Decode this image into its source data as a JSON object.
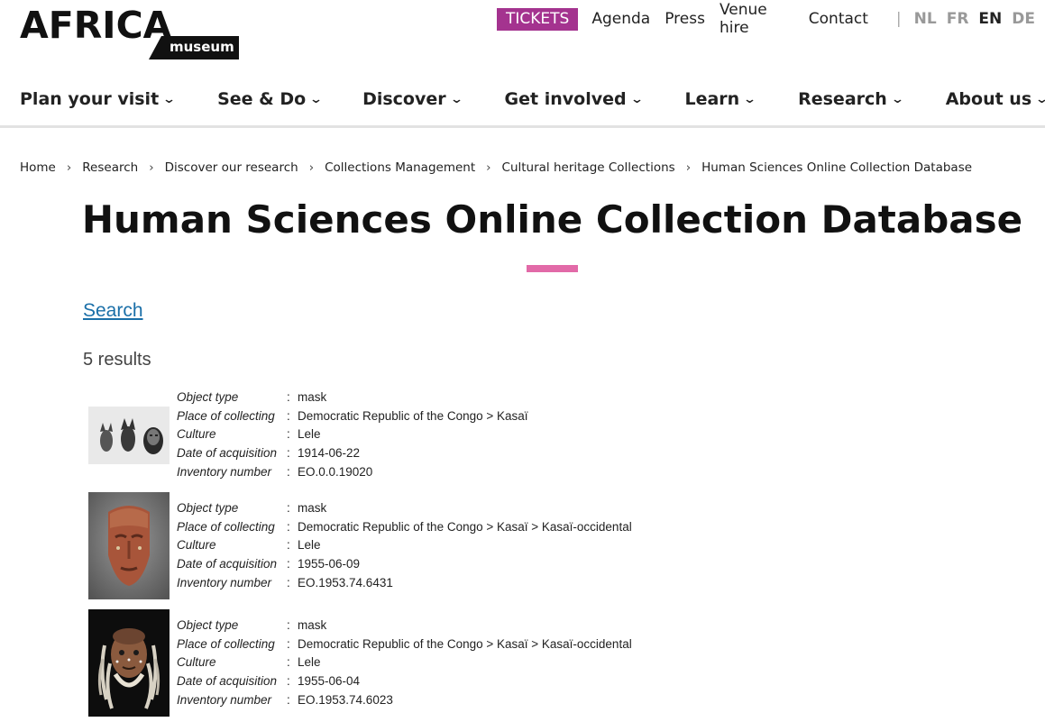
{
  "logo": {
    "word": "AFRICA",
    "sub": "museum"
  },
  "topnav": {
    "tickets": "TICKETS",
    "links": [
      "Agenda",
      "Press",
      "Venue hire",
      "Contact"
    ],
    "separator": "|",
    "languages": [
      "NL",
      "FR",
      "EN",
      "DE"
    ],
    "active_language": "EN"
  },
  "mainnav": [
    "Plan your visit",
    "See & Do",
    "Discover",
    "Get involved",
    "Learn",
    "Research",
    "About us"
  ],
  "breadcrumb": [
    "Home",
    "Research",
    "Discover our research",
    "Collections Management",
    "Cultural heritage Collections",
    "Human Sciences Online Collection Database"
  ],
  "page": {
    "title": "Human Sciences Online Collection Database",
    "search_link": "Search",
    "results_count": "5 results"
  },
  "field_labels": {
    "object_type": "Object type",
    "place": "Place of collecting",
    "culture": "Culture",
    "date": "Date of acquisition",
    "inventory": "Inventory number"
  },
  "results": [
    {
      "object_type": "mask",
      "place": "Democratic Republic of the Congo > Kasaï",
      "culture": "Lele",
      "date": "1914-06-22",
      "inventory": "EO.0.0.19020"
    },
    {
      "object_type": "mask",
      "place": "Democratic Republic of the Congo > Kasaï > Kasaï-occidental",
      "culture": "Lele",
      "date": "1955-06-09",
      "inventory": "EO.1953.74.6431"
    },
    {
      "object_type": "mask",
      "place": "Democratic Republic of the Congo > Kasaï > Kasaï-occidental",
      "culture": "Lele",
      "date": "1955-06-04",
      "inventory": "EO.1953.74.6023"
    }
  ],
  "colors": {
    "tickets_bg": "#a4338f",
    "accent": "#e26aa8",
    "link": "#1a6fa8"
  }
}
